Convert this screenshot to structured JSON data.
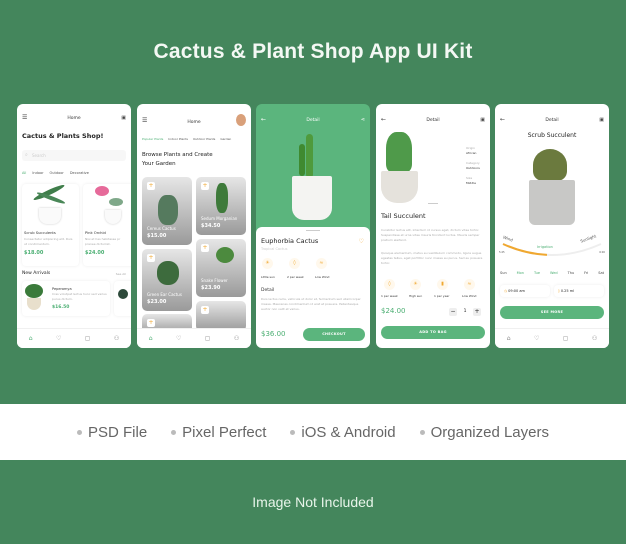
{
  "title": "Cactus & Plant Shop App UI Kit",
  "screen1": {
    "header": "Home",
    "heading": "Cactus & Plants Shop!",
    "search_placeholder": "Search",
    "tabs": [
      "All",
      "Indoor",
      "Outdoor",
      "Decorative"
    ],
    "products": [
      {
        "name": "Scrub Succulents",
        "desc": "Consectetur adipiscing elit. Duis ut condimentum.",
        "price": "$18.00"
      },
      {
        "name": "Pink Orchid",
        "desc": "Nisi et has habitasse pr pranee dictumst.",
        "price": "$24.00"
      }
    ],
    "new_arrivals": "New Arrivals",
    "see_all": "See All",
    "arrival": {
      "name": "Peperomya",
      "desc": "Cras volutpat lectus hunc sed varius purus dictum.",
      "price": "$16.50"
    }
  },
  "screen2": {
    "header": "Home",
    "tabs": [
      "Popular Plants",
      "Indoor Plants",
      "Outdoor Plants",
      "Garden"
    ],
    "heading_line1": "Browse Plants and Create",
    "heading_line2": "Your Garden",
    "cards": [
      {
        "name": "Cereus Cactus",
        "price": "$15.00"
      },
      {
        "name": "Sedum Morganian",
        "price": "$34.50"
      },
      {
        "name": "Green Ear Cactus",
        "price": "$23.00"
      },
      {
        "name": "Snake Flower",
        "price": "$23.90"
      }
    ]
  },
  "screen3": {
    "header": "Detail",
    "name": "Euphorbia Cactus",
    "subtitle": "Tropical Cactus",
    "features": [
      "Little sun",
      "2 per week",
      "Low Wind"
    ],
    "detail_label": "Detail",
    "detail_text": "Duis lectus nulla, vehicula ut dolor et, fermentum sed ullamcorper massa. Maecenas condimentum id erat et posuere. Pellentesque auctor non velit et varius.",
    "price": "$36.00",
    "checkout": "CHECKOUT"
  },
  "screen4": {
    "header": "Detail",
    "specs": [
      {
        "label": "Origin",
        "value": "African"
      },
      {
        "label": "Category",
        "value": "Outdoors"
      },
      {
        "label": "Size",
        "value": "Middle"
      }
    ],
    "name": "Tail Succulent",
    "para1": "Curabitur lectus elit, interdum id cursus eget, dictum vitae tortor. Suspendisse et urna vitae mauris tincidunt luctus. Mauris semper pretium eleifend.",
    "para2": "Quisque elementum, metus eu vestibulum commodo, ligula augue egestas tellus, eget porttitor nunc massa eu purus. Sed eu posuere tortor.",
    "features": [
      "1 per week",
      "High sun",
      "1 per year",
      "Low Wind"
    ],
    "price": "$24.00",
    "quantity": "1",
    "add_to_bag": "ADD TO BAG"
  },
  "screen5": {
    "header": "Detail",
    "name": "Scrub Succulent",
    "gauge_labels": {
      "left": "Wind",
      "center": "Irrigation",
      "right": "Sunlight",
      "min": "5:45",
      "max": "6:00"
    },
    "gauge_progress": 0.45,
    "days": [
      "Sun",
      "Mon",
      "Tue",
      "Wed",
      "Thu",
      "Fri",
      "Sat"
    ],
    "active_days": [
      "Mon",
      "Tue",
      "Wed"
    ],
    "time": "09:00 am",
    "water": "0.25 ml",
    "see_more": "SEE MORE"
  },
  "features": [
    "PSD File",
    "Pixel Perfect",
    "iOS & Android",
    "Organized Layers"
  ],
  "footer": "Image Not Included"
}
